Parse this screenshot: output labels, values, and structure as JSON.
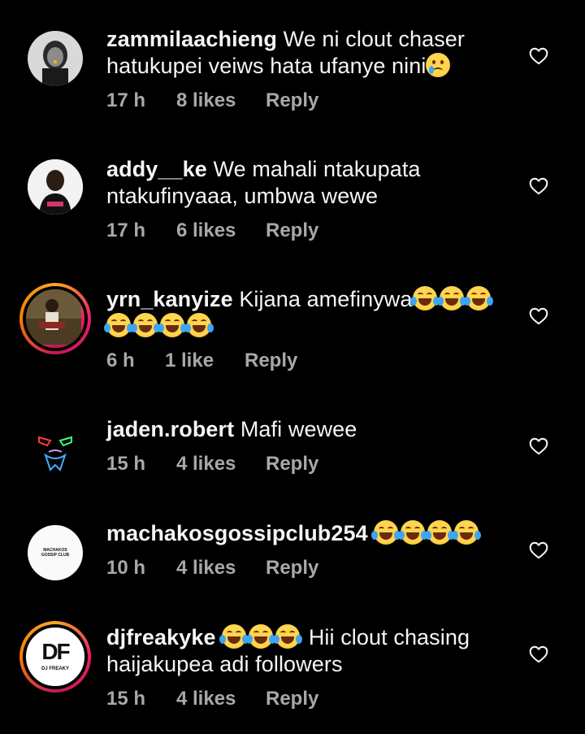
{
  "comments": [
    {
      "username": "zammilaachieng",
      "text_lines": [
        "We ni clout chaser",
        "hatukupei veiws hata ufanye nini"
      ],
      "emoji_end": "crying-face",
      "time": "17 h",
      "likes": "8 likes",
      "reply": "Reply",
      "avatar": "grayscale-portrait"
    },
    {
      "username": "addy__ke",
      "text_lines": [
        "We mahali ntakupata",
        "ntakufinyaaa, umbwa wewe"
      ],
      "time": "17 h",
      "likes": "6 likes",
      "reply": "Reply",
      "avatar": "portrait-white-bg"
    },
    {
      "username": "yrn_kanyize",
      "text_lines": [
        "Kijana amefinywa"
      ],
      "emoji_line1_count": 3,
      "emoji_line2_count": 4,
      "emoji": "face-with-tears-of-joy",
      "time": "6 h",
      "likes": "1 like",
      "reply": "Reply",
      "avatar": "portrait-with-story-ring"
    },
    {
      "username": "jaden.robert",
      "text_lines": [
        "Mafi wewee"
      ],
      "time": "15 h",
      "likes": "4 likes",
      "reply": "Reply",
      "avatar": "neon-mask"
    },
    {
      "username": "machakosgossipclub254",
      "text_lines": [
        ""
      ],
      "emoji_count": 4,
      "emoji": "face-with-tears-of-joy",
      "time": "10 h",
      "likes": "4 likes",
      "reply": "Reply",
      "avatar": "logo-white",
      "avatar_text": "MACHAKOS GOSSIP CLUB"
    },
    {
      "username": "djfreakyke",
      "emoji_after_user": 3,
      "text_lines": [
        "Hii clout chasing",
        "haijakupea adi followers"
      ],
      "emoji": "face-with-tears-of-joy",
      "time": "15 h",
      "likes": "4 likes",
      "reply": "Reply",
      "avatar": "dj-freaky-logo",
      "avatar_text": "DF",
      "avatar_subtext": "DJ FREAKY"
    }
  ],
  "icons": {
    "like": "heart-outline-icon"
  },
  "colors": {
    "background": "#000000",
    "text": "#f5f5f5",
    "meta": "#a8a8a8"
  }
}
